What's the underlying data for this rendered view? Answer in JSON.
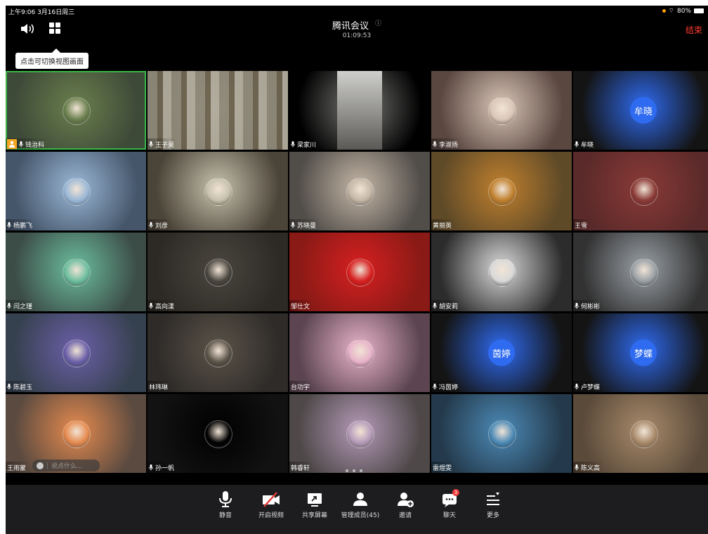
{
  "status_bar": {
    "time": "上午9:06 3月16日周三",
    "battery": "80%"
  },
  "header": {
    "title": "腾讯会议",
    "info_icon": "ⓘ",
    "timer": "01:09:53",
    "end_label": "结束"
  },
  "tooltip": "点击可切换视图画面",
  "participants": [
    {
      "name": "钱治科",
      "avatar": "photo",
      "bg": "#3e4a38",
      "accent": "#6a7f4d",
      "host": true,
      "active": true
    },
    {
      "name": "王子昊",
      "avatar": "video",
      "bg": "#6b6555",
      "accent": "#9d9682"
    },
    {
      "name": "梁家川",
      "avatar": "portrait-video",
      "bg": "#000000",
      "accent": "#7a7a78"
    },
    {
      "name": "李淑扬",
      "avatar": "photo",
      "bg": "#5a4740",
      "accent": "#d9c6b8"
    },
    {
      "name": "牟晓",
      "avatar": "text",
      "avatar_text": "牟晓",
      "bg": "#141414",
      "accent": "#2f6bf0"
    },
    {
      "name": "杨鹏飞",
      "avatar": "photo",
      "bg": "#45566a",
      "accent": "#9ab7d6"
    },
    {
      "name": "刘彦",
      "avatar": "photo",
      "bg": "#4b4438",
      "accent": "#c6c0ad"
    },
    {
      "name": "苏晓曼",
      "avatar": "photo",
      "bg": "#514d49",
      "accent": "#c4b6a6"
    },
    {
      "name": "黄丽英",
      "avatar": "photo",
      "bg": "#5f4a28",
      "accent": "#c0802e",
      "no_mic": true
    },
    {
      "name": "王雪",
      "avatar": "photo",
      "bg": "#5a2a2a",
      "accent": "#8a3a36",
      "no_mic": true
    },
    {
      "name": "闫之瑾",
      "avatar": "photo",
      "bg": "#3c4c47",
      "accent": "#6bbd9e"
    },
    {
      "name": "高向漾",
      "avatar": "photo",
      "bg": "#2d2a25",
      "accent": "#4a463f"
    },
    {
      "name": "邹仕文",
      "avatar": "photo",
      "bg": "#8a1a16",
      "accent": "#d62020",
      "no_mic": true
    },
    {
      "name": "胡安莉",
      "avatar": "photo",
      "bg": "#2c2c2c",
      "accent": "#d9d9d9"
    },
    {
      "name": "何彬彬",
      "avatar": "photo",
      "bg": "#323232",
      "accent": "#9aa0a6"
    },
    {
      "name": "陈碧玉",
      "avatar": "photo",
      "bg": "#36414f",
      "accent": "#6b5fa8"
    },
    {
      "name": "林玮琳",
      "avatar": "photo",
      "bg": "#2e2b29",
      "accent": "#5b5348",
      "no_mic": true
    },
    {
      "name": "台功宇",
      "avatar": "photo",
      "bg": "#5c4550",
      "accent": "#e7b2c8",
      "no_mic": true
    },
    {
      "name": "冯茵婷",
      "avatar": "text",
      "avatar_text": "茵婷",
      "bg": "#141414",
      "accent": "#2f6bf0"
    },
    {
      "name": "卢梦蝶",
      "avatar": "text",
      "avatar_text": "梦蝶",
      "bg": "#141414",
      "accent": "#2f6bf0"
    },
    {
      "name": "王雨蒙",
      "avatar": "photo",
      "bg": "#5a4a40",
      "accent": "#e58a4e",
      "no_mic": true,
      "chat": true
    },
    {
      "name": "孙一帆",
      "avatar": "photo",
      "bg": "#121212",
      "accent": "#000000"
    },
    {
      "name": "韩睿轩",
      "avatar": "photo",
      "bg": "#4e4848",
      "accent": "#b49ab8",
      "no_mic": true
    },
    {
      "name": "雷煜雯",
      "avatar": "photo",
      "bg": "#243a4c",
      "accent": "#4c8ab6",
      "no_mic": true
    },
    {
      "name": "陈义高",
      "avatar": "photo",
      "bg": "#5a4a3a",
      "accent": "#a88a6a"
    }
  ],
  "chat_input": {
    "placeholder": "说点什么..."
  },
  "toolbar": {
    "mute": "静音",
    "video": "开启视频",
    "share": "共享屏幕",
    "members": "管理成员(45)",
    "invite": "邀请",
    "chat": "聊天",
    "chat_badge": "3",
    "more": "更多"
  }
}
